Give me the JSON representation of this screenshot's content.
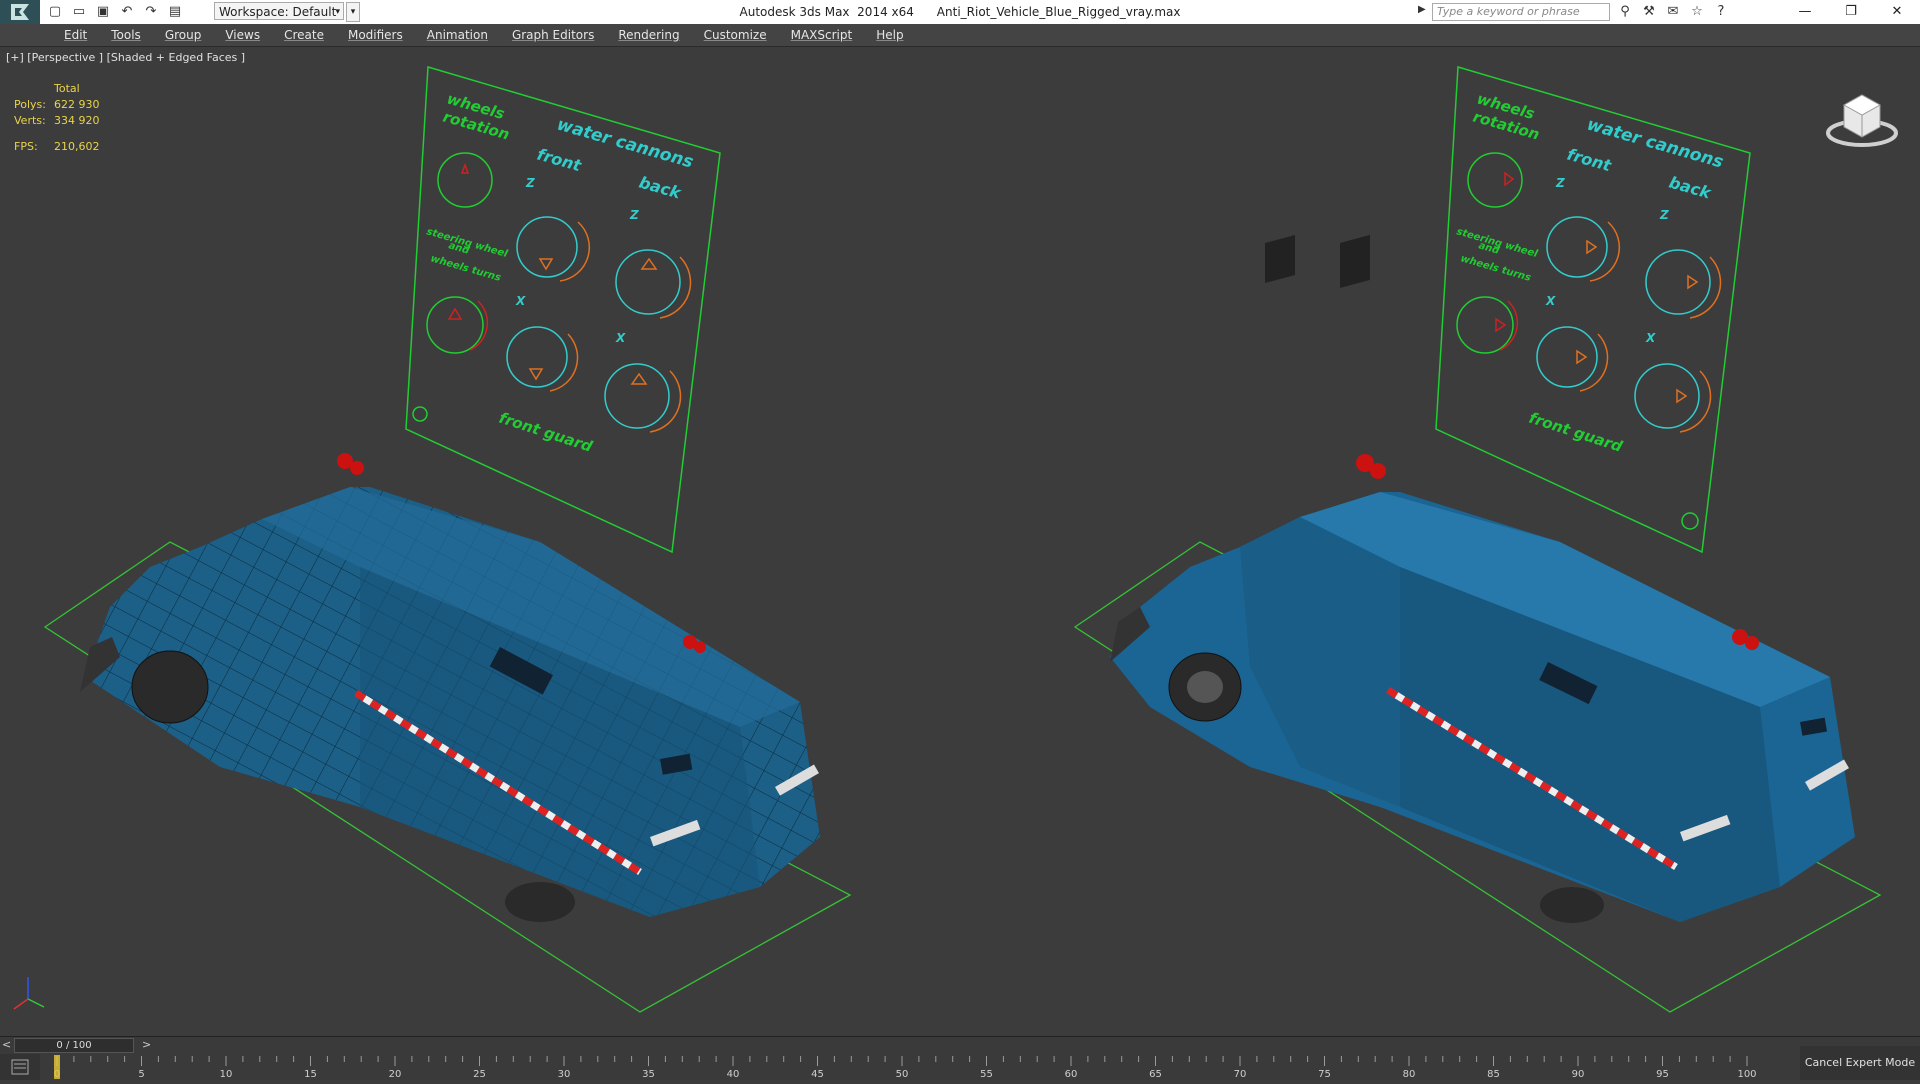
{
  "titlebar": {
    "app": "Autodesk 3ds Max",
    "version": "2014 x64",
    "filename": "Anti_Riot_Vehicle_Blue_Rigged_vray.max",
    "workspace": "Workspace: Default",
    "search_placeholder": "Type a keyword or phrase"
  },
  "menu": [
    "Edit",
    "Tools",
    "Group",
    "Views",
    "Create",
    "Modifiers",
    "Animation",
    "Graph Editors",
    "Rendering",
    "Customize",
    "MAXScript",
    "Help"
  ],
  "viewport": {
    "label": "[+] [Perspective ] [Shaded + Edged Faces ]",
    "stats": {
      "header": "Total",
      "polys_label": "Polys:",
      "polys": "622 930",
      "verts_label": "Verts:",
      "verts": "334 920",
      "fps_label": "FPS:",
      "fps": "210,602"
    }
  },
  "rig_panel": {
    "wheels": "wheels",
    "rotation": "rotation",
    "water_cannons": "water cannons",
    "front": "front",
    "back": "back",
    "z": "Z",
    "x": "X",
    "steering1": "steering wheel",
    "steering2": "and",
    "steering3": "wheels turns",
    "front_guard": "front guard"
  },
  "timeline": {
    "frame": "0 / 100",
    "ticks": [
      "0",
      "5",
      "10",
      "15",
      "20",
      "25",
      "30",
      "35",
      "40",
      "45",
      "50",
      "55",
      "60",
      "65",
      "70",
      "75",
      "80",
      "85",
      "90",
      "95",
      "100"
    ]
  },
  "status": {
    "expert": "Cancel Expert Mode"
  },
  "colors": {
    "vehicle": "#1c5f87",
    "rig": "#22cc33",
    "cyan": "#33cccc",
    "orange": "#e07020",
    "grid": "#35c235"
  }
}
